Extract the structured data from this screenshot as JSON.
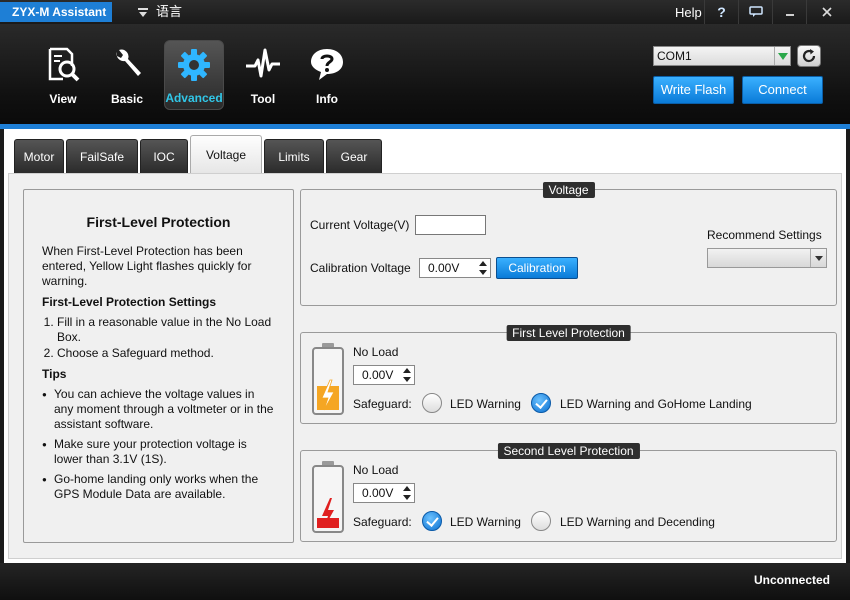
{
  "window": {
    "title": "ZYX-M Assistant",
    "language_label": "语言",
    "help_label": "Help"
  },
  "nav": {
    "items": [
      {
        "label": "View",
        "icon": "magnifier-document-icon"
      },
      {
        "label": "Basic",
        "icon": "wrench-icon"
      },
      {
        "label": "Advanced",
        "icon": "gear-icon"
      },
      {
        "label": "Tool",
        "icon": "pulse-wave-icon"
      },
      {
        "label": "Info",
        "icon": "speech-bubble-question-icon"
      }
    ],
    "active": "Advanced"
  },
  "connection": {
    "port_value": "COM1",
    "write_flash_label": "Write Flash",
    "connect_label": "Connect"
  },
  "tabs": [
    {
      "label": "Motor"
    },
    {
      "label": "FailSafe"
    },
    {
      "label": "IOC"
    },
    {
      "label": "Voltage"
    },
    {
      "label": "Limits"
    },
    {
      "label": "Gear"
    }
  ],
  "active_tab": "Voltage",
  "info": {
    "title": "First-Level Protection",
    "intro": "When First-Level Protection has been entered, Yellow Light flashes quickly for warning.",
    "settings_heading": "First-Level Protection Settings",
    "settings_steps": [
      "Fill in a reasonable value in the No Load Box.",
      "Choose a Safeguard method."
    ],
    "tips_heading": "Tips",
    "tips": [
      "You can achieve the voltage values in any moment through a voltmeter or in the assistant software.",
      "Make sure your protection voltage is lower than 3.1V (1S).",
      "Go-home landing only works when the GPS Module Data are available."
    ]
  },
  "voltage": {
    "title": "Voltage",
    "current_voltage_label": "Current Voltage(V)",
    "current_voltage_value": "",
    "calibration_voltage_label": "Calibration Voltage",
    "calibration_voltage_value": "0.00V",
    "calibration_button": "Calibration",
    "recommend_label": "Recommend Settings",
    "recommend_value": ""
  },
  "first_level": {
    "title": "First Level Protection",
    "no_load_label": "No Load",
    "no_load_value": "0.00V",
    "safeguard_label": "Safeguard:",
    "option_a": "LED Warning",
    "option_b": "LED Warning and GoHome Landing",
    "selected": "option_b",
    "battery_color": "#f5a623"
  },
  "second_level": {
    "title": "Second Level Protection",
    "no_load_label": "No Load",
    "no_load_value": "0.00V",
    "safeguard_label": "Safeguard:",
    "option_a": "LED Warning",
    "option_b": "LED Warning and Decending",
    "selected": "option_a",
    "battery_color": "#e02020"
  },
  "status": {
    "text": "Unconnected"
  }
}
